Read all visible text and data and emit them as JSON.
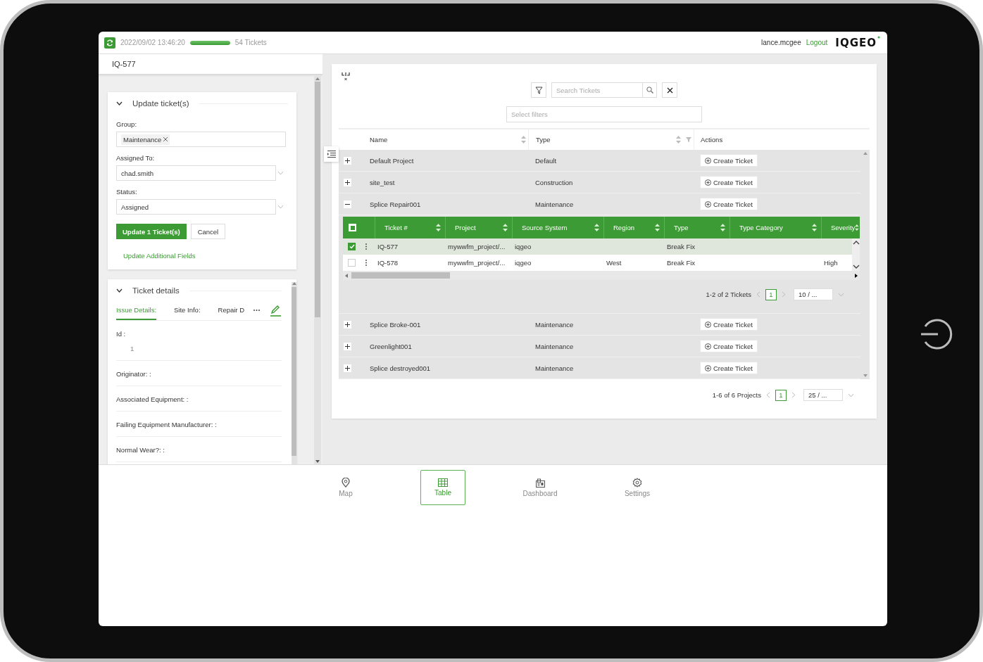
{
  "status_bar": {
    "timestamp": "2022/09/02 13:46:20",
    "level": 1,
    "tickets": "54 Tickets",
    "user": "lance.mcgee",
    "logout": "Logout",
    "logo": "IQGEO"
  },
  "ticket_title": "IQ-577",
  "update_panel": {
    "title": "Update ticket(s)",
    "expanded": true,
    "group_label": "Group:",
    "group_tags": [
      "Maintenance"
    ],
    "assigned_label": "Assigned To:",
    "assigned_value": "chad.smith",
    "status_label": "Status:",
    "status_value": "Assigned",
    "primary_button": "Update 1 Ticket(s)",
    "cancel_button": "Cancel",
    "link": "Update Additional Fields"
  },
  "details_panel": {
    "title": "Ticket details",
    "expanded": true,
    "tabs": [
      {
        "label": "Issue Details:",
        "selected": true
      },
      {
        "label": "Site Info:",
        "selected": false
      },
      {
        "label": "Repair D",
        "selected": false
      }
    ],
    "fields": [
      {
        "label": "Id :",
        "value": "1"
      },
      {
        "label": "Originator: :"
      },
      {
        "label": "Associated Equipment: :"
      },
      {
        "label": "Failing Equipment Manufacturer: :"
      },
      {
        "label": "Normal Wear?: :"
      }
    ]
  },
  "toolbar": {
    "search_placeholder": "Search Tickets",
    "filter_placeholder": "Select filters"
  },
  "projects": {
    "columns": [
      "Name",
      "Type",
      "Actions"
    ],
    "rows": [
      {
        "name": "Default Project",
        "type": "Default",
        "action": "Create Ticket",
        "expanded": false
      },
      {
        "name": "site_test",
        "type": "Construction",
        "action": "Create Ticket",
        "expanded": false
      },
      {
        "name": "Splice Repair001",
        "type": "Maintenance",
        "action": "Create Ticket",
        "expanded": true,
        "tickets": {
          "select_all_partial": true,
          "columns": [
            "Ticket #",
            "Project",
            "Source System",
            "Region",
            "Type",
            "Type Category",
            "Severity"
          ],
          "rows": [
            {
              "selected": true,
              "ticket": "IQ-577",
              "project": "mywwfm_project/...",
              "source_system": "iqgeo",
              "type": "Break Fix"
            },
            {
              "selected": false,
              "ticket": "IQ-578",
              "project": "mywwfm_project/...",
              "source_system": "iqgeo",
              "region": "West",
              "type": "Break Fix",
              "severity": "High"
            }
          ],
          "pagination": {
            "summary": "1-2 of 2 Tickets",
            "page": "1",
            "page_size": "10 / ..."
          }
        }
      },
      {
        "name": "Splice Broke-001",
        "type": "Maintenance",
        "action": "Create Ticket",
        "expanded": false
      },
      {
        "name": "Greenlight001",
        "type": "Maintenance",
        "action": "Create Ticket",
        "expanded": false
      },
      {
        "name": "Splice destroyed001",
        "type": "Maintenance",
        "action": "Create Ticket",
        "expanded": false
      }
    ],
    "pagination": {
      "summary": "1-6 of 6 Projects",
      "page": "1",
      "page_size": "25 / ..."
    }
  },
  "nav": [
    {
      "label": "Map",
      "selected": false
    },
    {
      "label": "Table",
      "selected": true
    },
    {
      "label": "Dashboard",
      "selected": false
    },
    {
      "label": "Settings",
      "selected": false
    }
  ]
}
